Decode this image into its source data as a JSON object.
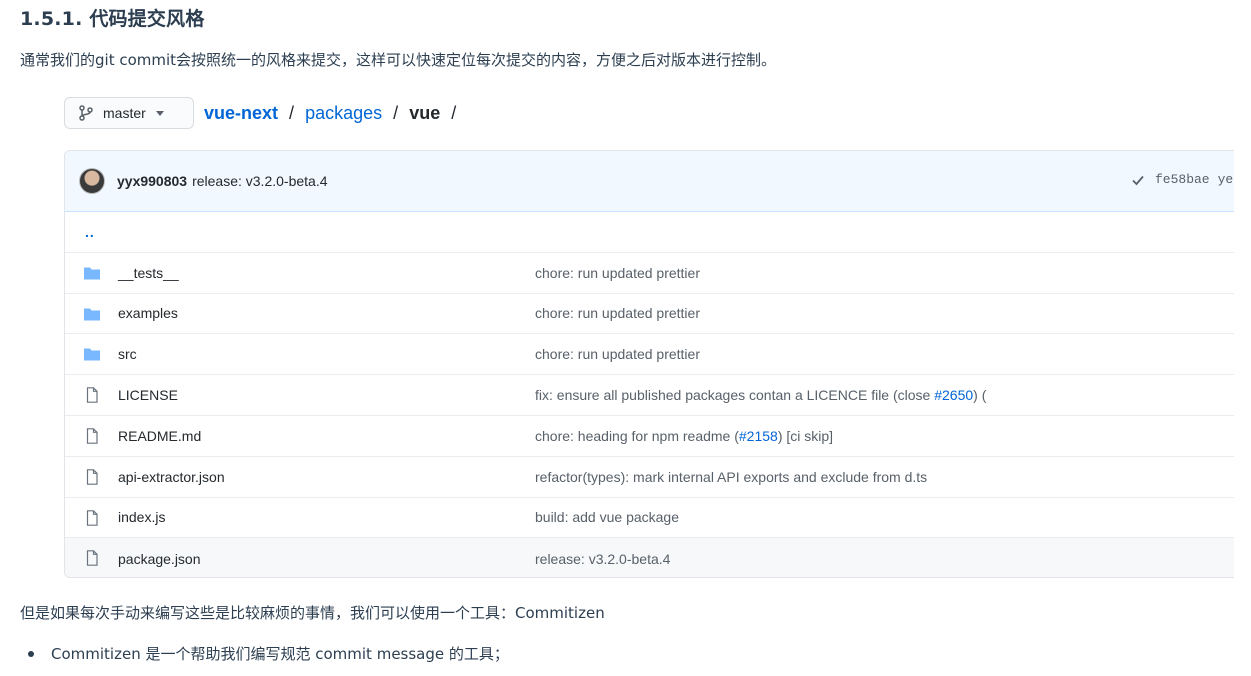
{
  "heading": "1.5.1. 代码提交风格",
  "intro": "通常我们的git commit会按照统一的风格来提交，这样可以快速定位每次提交的内容，方便之后对版本进行控制。",
  "branch": {
    "label": "master"
  },
  "breadcrumb": {
    "repo": "vue-next",
    "folder": "packages",
    "current": "vue",
    "sep": "/"
  },
  "commit": {
    "author": "yyx990803",
    "message": "release: v3.2.0-beta.4",
    "hash": "fe58bae",
    "hash_overflow": "ye"
  },
  "updir": "..",
  "files": [
    {
      "name": "__tests__",
      "type": "folder",
      "msg": "chore: run updated prettier"
    },
    {
      "name": "examples",
      "type": "folder",
      "msg": "chore: run updated prettier"
    },
    {
      "name": "src",
      "type": "folder",
      "msg": "chore: run updated prettier"
    },
    {
      "name": "LICENSE",
      "type": "file",
      "msg_prefix": "fix: ensure all published packages contan a LICENCE file (close ",
      "msg_link": "#2650",
      "msg_suffix": ") ("
    },
    {
      "name": "README.md",
      "type": "file",
      "msg_prefix": "chore: heading for npm readme (",
      "msg_link": "#2158",
      "msg_suffix": ") [ci skip]"
    },
    {
      "name": "api-extractor.json",
      "type": "file",
      "msg": "refactor(types): mark internal API exports and exclude from d.ts"
    },
    {
      "name": "index.js",
      "type": "file",
      "msg": "build: add vue package"
    },
    {
      "name": "package.json",
      "type": "file",
      "msg": "release: v3.2.0-beta.4"
    }
  ],
  "after_text": "但是如果每次手动来编写这些是比较麻烦的事情，我们可以使用一个工具：Commitizen",
  "bullets": [
    "Commitizen 是一个帮助我们编写规范 commit message 的工具；"
  ],
  "colors": {
    "link": "#0366d6",
    "folder_icon": "#79b8ff",
    "commit_bg": "#f1f8ff"
  }
}
